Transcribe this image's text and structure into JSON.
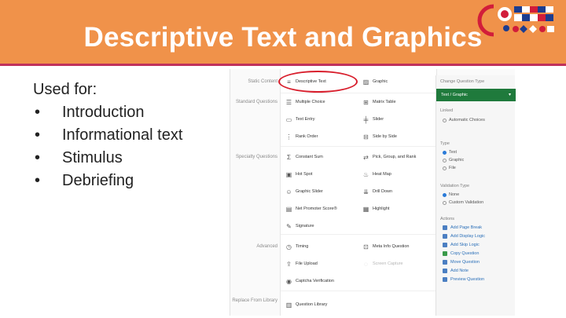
{
  "slide": {
    "title": "Descriptive Text and Graphics",
    "intro": "Used for:",
    "bullets": [
      "Introduction",
      "Informational text",
      "Stimulus",
      "Debriefing"
    ]
  },
  "colors": {
    "header_bg": "#f0924a",
    "header_rule": "#c0315c",
    "highlight_circle": "#d81e2c",
    "select_green": "#1f7a3c"
  },
  "screenshot": {
    "sections": {
      "static": "Static Content",
      "standard": "Standard Questions",
      "specialty": "Specialty Questions",
      "advanced": "Advanced",
      "replace": "Replace From Library"
    },
    "left_col": [
      {
        "label": "Descriptive Text",
        "icon": "text-icon"
      },
      {
        "label": "Multiple Choice",
        "icon": "list-icon"
      },
      {
        "label": "Text Entry",
        "icon": "text-entry-icon"
      },
      {
        "label": "Rank Order",
        "icon": "rank-icon"
      },
      {
        "label": "Constant Sum",
        "icon": "sum-icon"
      },
      {
        "label": "Hot Spot",
        "icon": "hotspot-icon"
      },
      {
        "label": "Graphic Slider",
        "icon": "slider-icon"
      },
      {
        "label": "Net Promoter Score®",
        "icon": "nps-icon"
      },
      {
        "label": "Signature",
        "icon": "pen-icon"
      },
      {
        "label": "Timing",
        "icon": "clock-icon"
      },
      {
        "label": "File Upload",
        "icon": "upload-icon"
      },
      {
        "label": "Captcha Verification",
        "icon": "captcha-icon"
      },
      {
        "label": "Question Library",
        "icon": "library-icon"
      }
    ],
    "right_col": [
      {
        "label": "Graphic",
        "icon": "image-icon",
        "dim": false
      },
      {
        "label": "Matrix Table",
        "icon": "matrix-icon",
        "dim": false
      },
      {
        "label": "Slider",
        "icon": "slider-icon",
        "dim": false
      },
      {
        "label": "Side by Side",
        "icon": "sidebyside-icon",
        "dim": false
      },
      {
        "label": "Pick, Group, and Rank",
        "icon": "pgr-icon",
        "dim": false
      },
      {
        "label": "Heat Map",
        "icon": "fire-icon",
        "dim": false
      },
      {
        "label": "Drill Down",
        "icon": "drilldown-icon",
        "dim": false
      },
      {
        "label": "Highlight",
        "icon": "highlight-icon",
        "dim": false
      },
      {
        "label": "Meta Info Question",
        "icon": "meta-icon",
        "dim": false
      },
      {
        "label": "Screen Capture",
        "icon": "capture-icon",
        "dim": true
      }
    ],
    "panel": {
      "heading": "Change Question Type",
      "selected_type": "Text / Graphic",
      "linked": "Linked",
      "linked_option": "Automatic Choices",
      "type_label": "Type",
      "type_options": [
        "Text",
        "Graphic",
        "File"
      ],
      "validation_label": "Validation Type",
      "validation_options": [
        "None",
        "Custom Validation"
      ],
      "actions_label": "Actions",
      "actions": [
        "Add Page Break",
        "Add Display Logic",
        "Add Skip Logic",
        "Copy Question",
        "Move Question",
        "Add Note",
        "Preview Question"
      ]
    }
  }
}
